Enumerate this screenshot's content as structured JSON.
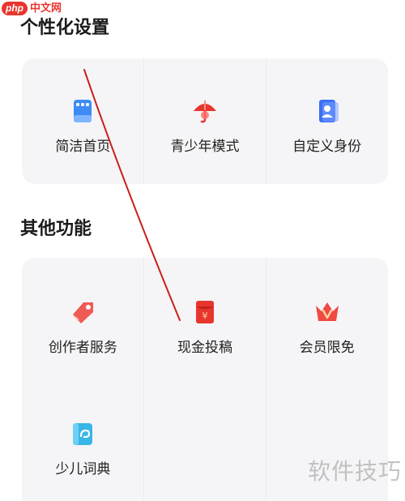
{
  "watermark_logo": {
    "badge": "php",
    "text": "中文网"
  },
  "sections": [
    {
      "title": "个性化设置",
      "items": [
        {
          "label": "简洁首页",
          "icon": "simple-home-icon"
        },
        {
          "label": "青少年模式",
          "icon": "teen-mode-umbrella-icon"
        },
        {
          "label": "自定义身份",
          "icon": "custom-identity-icon"
        }
      ]
    },
    {
      "title": "其他功能",
      "items": [
        {
          "label": "创作者服务",
          "icon": "creator-tag-icon"
        },
        {
          "label": "现金投稿",
          "icon": "cash-envelope-icon"
        },
        {
          "label": "会员限免",
          "icon": "vip-crown-icon"
        },
        {
          "label": "少儿词典",
          "icon": "kids-dictionary-icon"
        }
      ]
    }
  ],
  "watermark_text": "软件技巧",
  "colors": {
    "accent": "#e8362f",
    "card_bg": "#f5f5f7",
    "blue": "#3d8bf5"
  }
}
